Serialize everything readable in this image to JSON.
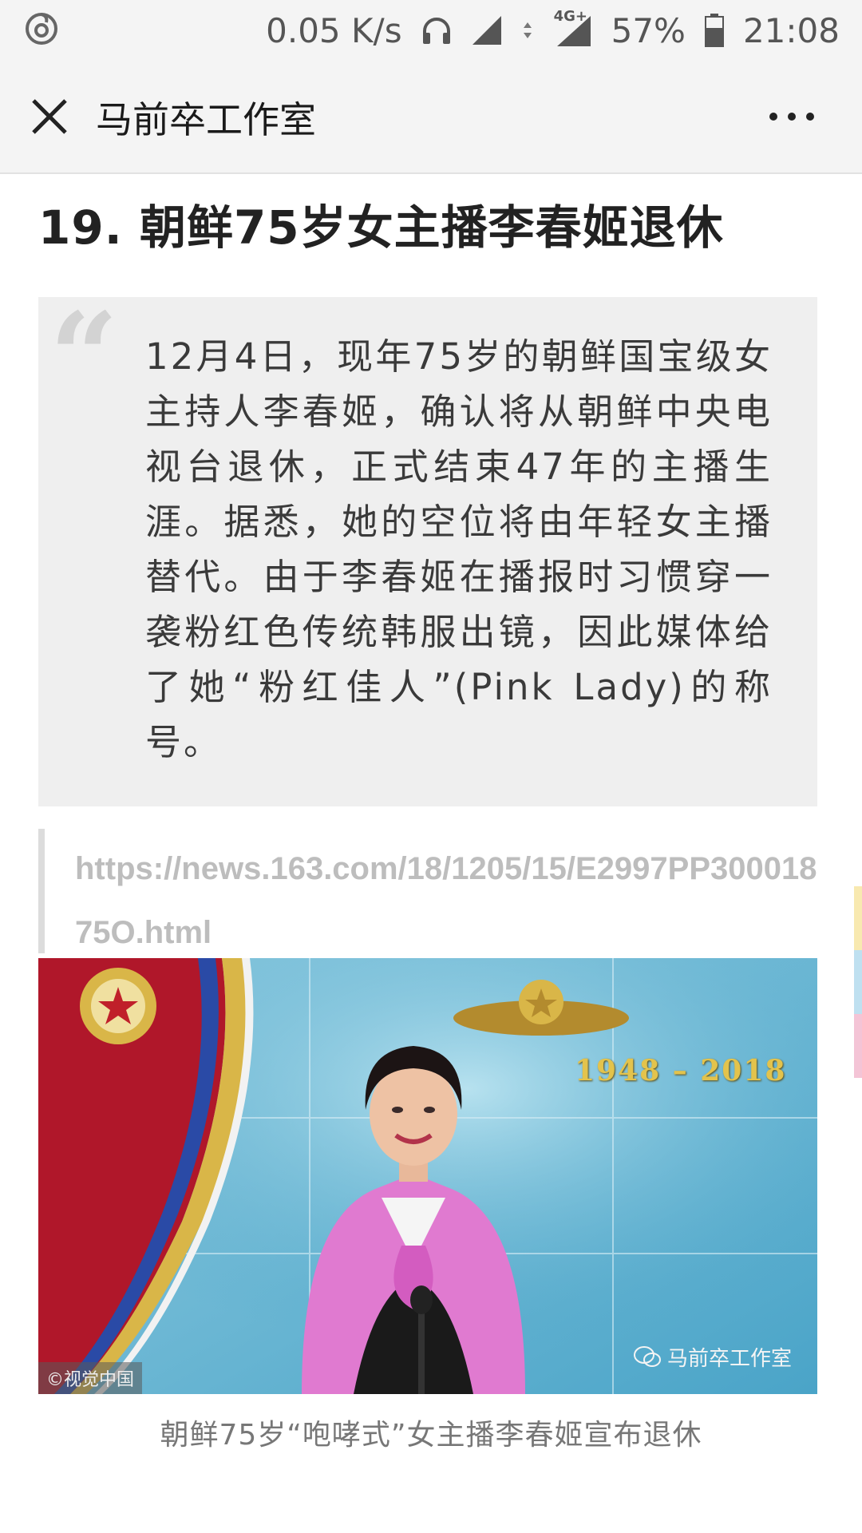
{
  "status_bar": {
    "speed": "0.05 K/s",
    "network": "4G+",
    "battery": "57%",
    "time": "21:08",
    "icons": [
      "netease-music-icon",
      "headphones-icon",
      "signal-icon",
      "data-arrows-icon",
      "battery-icon"
    ]
  },
  "nav": {
    "title": "马前卒工作室",
    "close_icon": "close-icon",
    "more_icon": "more-icon"
  },
  "article": {
    "heading": "19. 朝鲜75岁女主播李春姬退休",
    "quote": "12月4日，现年75岁的朝鲜国宝级女主持人李春姬，确认将从朝鲜中央电视台退休，正式结束47年的主播生涯。据悉，她的空位将由年轻女主播替代。由于李春姬在播报时习惯穿一袭粉红色传统韩服出镜，因此媒体给了她“粉红佳人”(Pink Lady)的称号。",
    "link": "https://news.163.com/18/1205/15/E2997PP30001875O.html",
    "photo": {
      "year_text": "1948 – 2018",
      "credit": "©视觉中国",
      "watermark": "马前卒工作室"
    },
    "caption": "朝鲜75岁“咆哮式”女主播李春姬宣布退休"
  },
  "colors": {
    "quote_bg": "#efefef",
    "link": "#bdbdbd",
    "hanbok_pink": "#e07ad0",
    "studio_blue": "#6fb6d2"
  }
}
